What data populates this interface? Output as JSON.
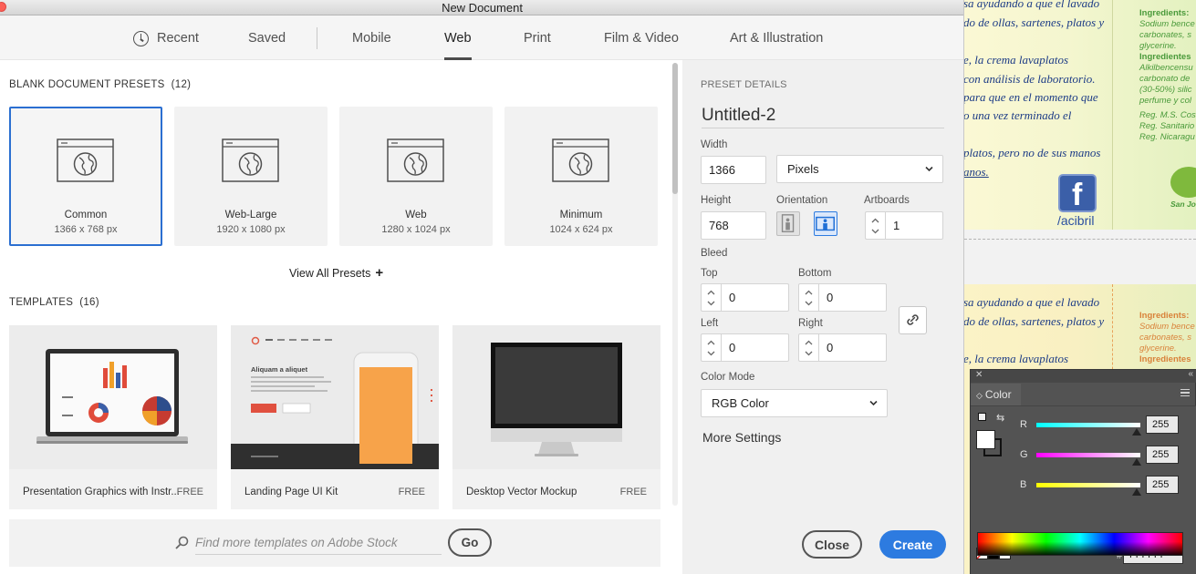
{
  "window": {
    "title": "New Document"
  },
  "tabs": [
    {
      "label": "Recent",
      "icon": "clock-icon"
    },
    {
      "label": "Saved"
    },
    {
      "label": "Mobile"
    },
    {
      "label": "Web",
      "active": true
    },
    {
      "label": "Print"
    },
    {
      "label": "Film & Video"
    },
    {
      "label": "Art & Illustration"
    }
  ],
  "blank_presets": {
    "heading": "BLANK DOCUMENT PRESETS",
    "count": "(12)",
    "items": [
      {
        "name": "Common",
        "size": "1366 x 768 px",
        "selected": true
      },
      {
        "name": "Web-Large",
        "size": "1920 x 1080 px"
      },
      {
        "name": "Web",
        "size": "1280 x 1024 px"
      },
      {
        "name": "Minimum",
        "size": "1024 x 624 px"
      }
    ],
    "view_all": "View All Presets",
    "view_all_icon": "+"
  },
  "templates": {
    "heading": "TEMPLATES",
    "count": "(16)",
    "items": [
      {
        "name": "Presentation Graphics with Instr...",
        "price": "FREE"
      },
      {
        "name": "Landing Page UI Kit",
        "price": "FREE",
        "thumb_headline": "Aliquam a aliquet"
      },
      {
        "name": "Desktop Vector Mockup",
        "price": "FREE"
      }
    ]
  },
  "stock": {
    "placeholder": "Find more templates on Adobe Stock",
    "go_label": "Go"
  },
  "preset_details": {
    "heading": "PRESET DETAILS",
    "name": "Untitled-2",
    "width_label": "Width",
    "width": "1366",
    "units": "Pixels",
    "height_label": "Height",
    "height": "768",
    "orientation_label": "Orientation",
    "orientation": "landscape",
    "artboards_label": "Artboards",
    "artboards": "1",
    "bleed_label": "Bleed",
    "top_label": "Top",
    "top": "0",
    "bottom_label": "Bottom",
    "bottom": "0",
    "left_label": "Left",
    "left": "0",
    "right_label": "Right",
    "right": "0",
    "color_mode_label": "Color Mode",
    "color_mode": "RGB Color",
    "more_settings": "More Settings",
    "close_label": "Close",
    "create_label": "Create"
  },
  "background_document": {
    "flyer_lines": [
      "sa ayudando a que el lavado",
      "do de ollas, sartenes, platos y",
      "e, la crema lavaplatos",
      "con análisis de laboratorio.",
      "para que en el momento que",
      "o una vez terminado el",
      "platos, pero no de sus manos",
      "anos."
    ],
    "ingredients_lines": [
      "Ingredients:",
      "Sodium bence",
      "carbonates, s",
      "glycerine.",
      "Ingredientes",
      "Alkilbencensu",
      "carbonato de",
      "(30-50%) silic",
      "perfume y col",
      "Reg. M.S. Cost",
      "Reg. Sanitario",
      "Reg. Nicaragu"
    ],
    "facebook_handle": "/acibril",
    "badge_text": "San Jos",
    "flyer2_lines": [
      "sa ayudando a que el lavado",
      "do de ollas, sartenes, platos y",
      "e, la crema lavaplatos"
    ],
    "ingredients2_lines": [
      "Ingredients:",
      "Sodium bence",
      "carbonates, s",
      "glycerine.",
      "Ingredientes"
    ]
  },
  "color_panel": {
    "title": "Color",
    "r_label": "R",
    "r": "255",
    "g_label": "G",
    "g": "255",
    "b_label": "B",
    "b": "255",
    "hex_symbol": "#",
    "hex": "FFFFFF"
  },
  "colors": {
    "accent": "#2d7be0",
    "selection_border": "#2b6fd1"
  }
}
